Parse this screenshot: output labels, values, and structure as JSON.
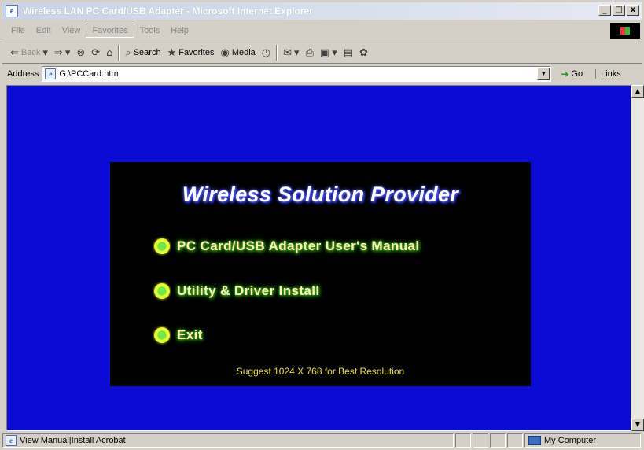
{
  "window": {
    "title": "Wireless LAN PC Card/USB Adapter - Microsoft Internet Explorer",
    "min_label": "_",
    "max_label": "□",
    "close_label": "x"
  },
  "menubar": {
    "items": [
      "File",
      "Edit",
      "View",
      "Favorites",
      "Tools",
      "Help"
    ]
  },
  "toolbar": {
    "back_label": "Back",
    "search_label": "Search",
    "favorites_label": "Favorites",
    "media_label": "Media"
  },
  "address": {
    "label": "Address",
    "value": "G:\\PCCard.htm",
    "go_label": "Go",
    "links_label": "Links"
  },
  "page": {
    "title": "Wireless Solution Provider",
    "links": [
      "PC Card/USB Adapter User's Manual",
      "Utility & Driver Install",
      "Exit"
    ],
    "suggestion": "Suggest 1024 X 768 for Best Resolution",
    "colors": {
      "background": "#0c0bd6",
      "panel": "#000000",
      "link_glow": "#2e9a1a",
      "bullet": "#e7ff2c"
    }
  },
  "status": {
    "text": "View Manual|Install Acrobat",
    "zone": "My Computer"
  }
}
